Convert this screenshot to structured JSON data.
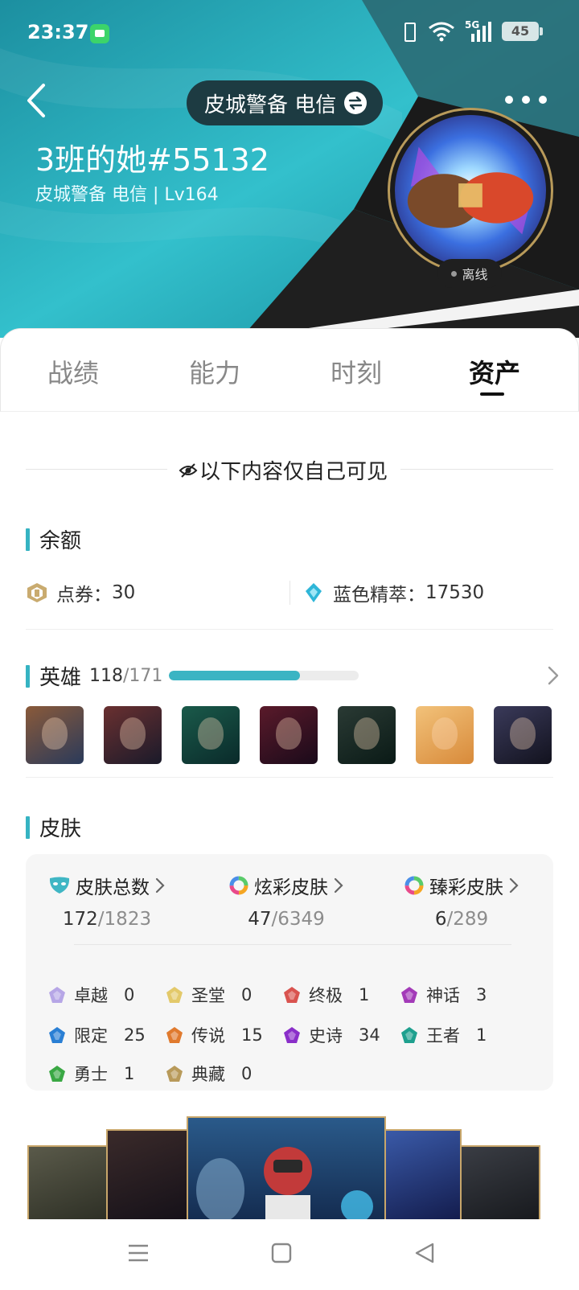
{
  "status_bar": {
    "time": "23:37",
    "network": "5G",
    "battery": "45"
  },
  "header": {
    "server_label": "皮城警备 电信",
    "player_name": "3班的她#55132",
    "player_sub": "皮城警备 电信 | Lv164",
    "status": "离线"
  },
  "tabs": [
    {
      "label": "战绩",
      "active": false
    },
    {
      "label": "能力",
      "active": false
    },
    {
      "label": "时刻",
      "active": false
    },
    {
      "label": "资产",
      "active": true
    }
  ],
  "privacy_notice": "以下内容仅自己可见",
  "balance": {
    "title": "余额",
    "coupons_label": "点券：",
    "coupons_value": "30",
    "essence_label": "蓝色精萃：",
    "essence_value": "17530"
  },
  "heroes": {
    "title": "英雄",
    "owned": "118",
    "total": "/171",
    "progress": 0.69,
    "thumbnails": [
      "hero-portrait-1",
      "hero-portrait-2",
      "hero-portrait-3",
      "hero-portrait-4",
      "hero-portrait-5",
      "hero-portrait-6",
      "hero-portrait-7"
    ]
  },
  "skins": {
    "title": "皮肤",
    "stats": [
      {
        "label": "皮肤总数",
        "owned": "172",
        "total": "/1823",
        "icon": "mask-icon"
      },
      {
        "label": "炫彩皮肤",
        "owned": "47",
        "total": "/6349",
        "icon": "chroma-ring-icon"
      },
      {
        "label": "臻彩皮肤",
        "owned": "6",
        "total": "/289",
        "icon": "chroma-ring-icon"
      }
    ],
    "rarities": [
      {
        "label": "卓越",
        "value": "0",
        "color": "#b6a6e6"
      },
      {
        "label": "圣堂",
        "value": "0",
        "color": "#e3c96a"
      },
      {
        "label": "终极",
        "value": "1",
        "color": "#d9534f"
      },
      {
        "label": "神话",
        "value": "3",
        "color": "#a33bb8"
      },
      {
        "label": "限定",
        "value": "25",
        "color": "#2a7fd4"
      },
      {
        "label": "传说",
        "value": "15",
        "color": "#e07a2e"
      },
      {
        "label": "史诗",
        "value": "34",
        "color": "#8a2fc9"
      },
      {
        "label": "王者",
        "value": "1",
        "color": "#1ea08e"
      },
      {
        "label": "勇士",
        "value": "1",
        "color": "#3aa844"
      },
      {
        "label": "典藏",
        "value": "0",
        "color": "#b89a5a"
      }
    ]
  },
  "colors": {
    "accent": "#35b3c2",
    "header_dark": "#1d3b42"
  }
}
